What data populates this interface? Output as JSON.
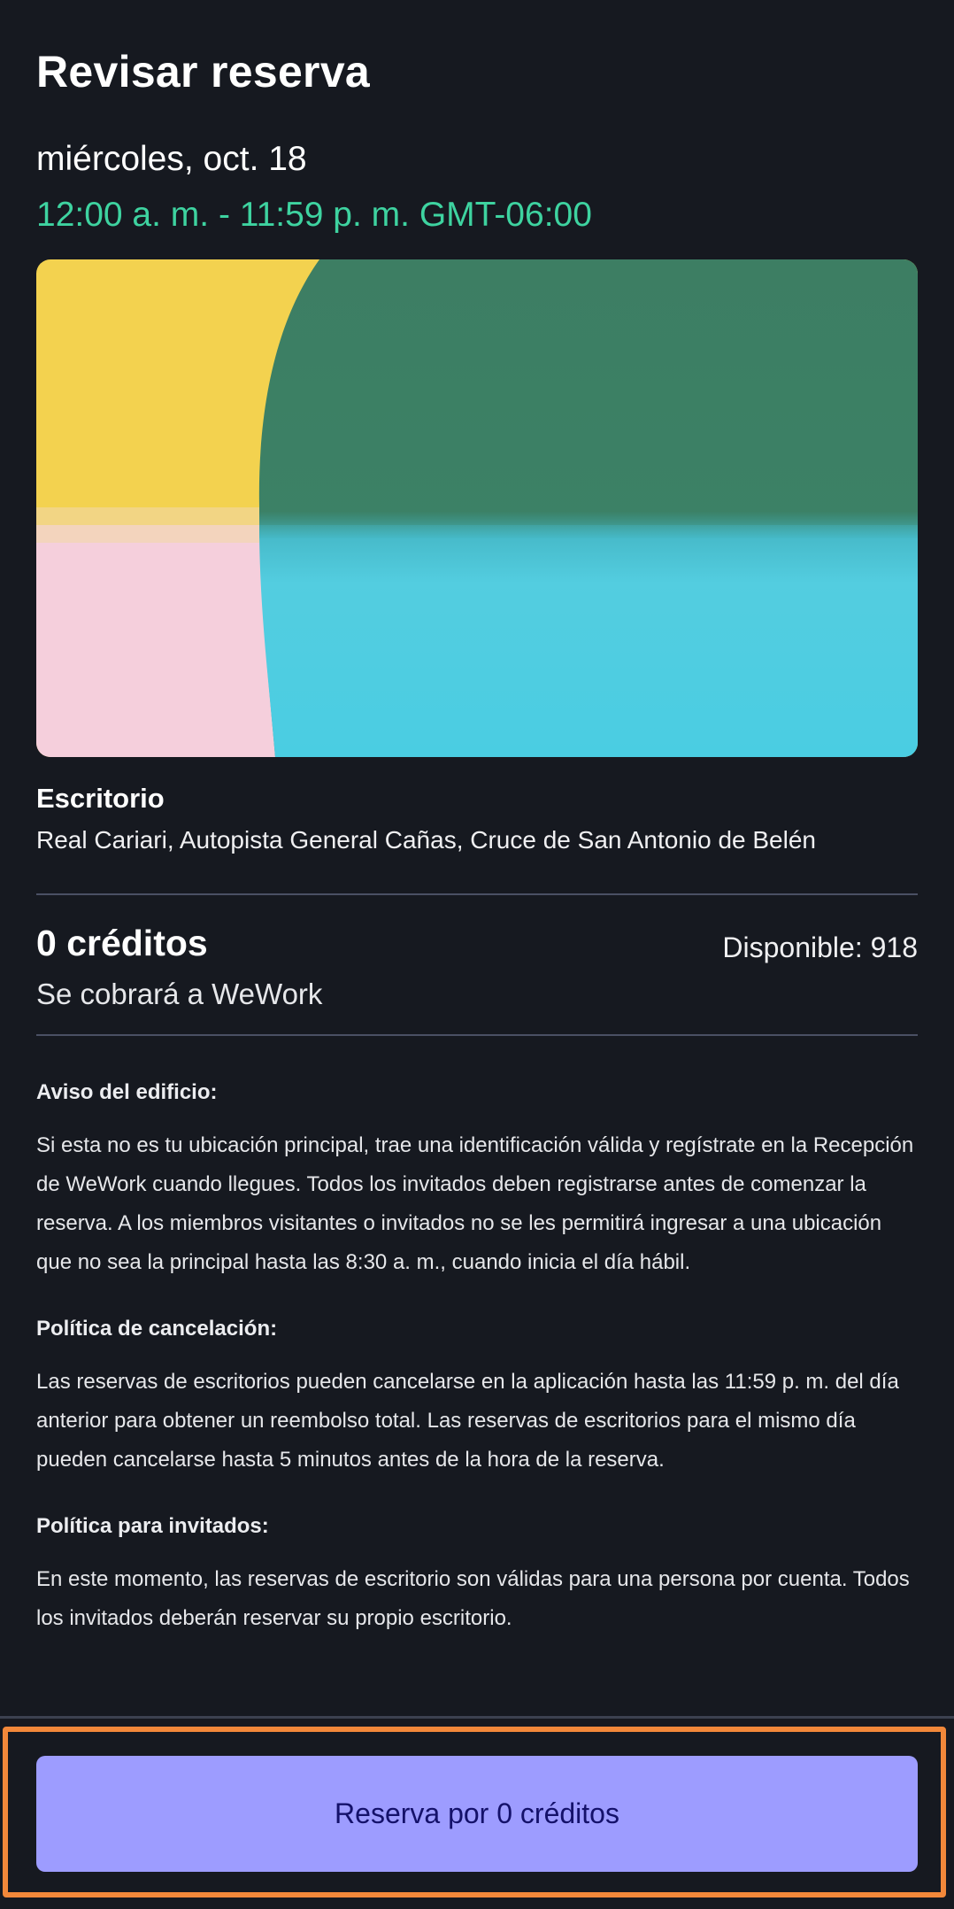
{
  "header": {
    "title": "Revisar reserva"
  },
  "booking": {
    "date": "miércoles, oct. 18",
    "time_range": "12:00 a. m. - 11:59 p. m. GMT-06:00"
  },
  "space": {
    "type": "Escritorio",
    "address": "Real Cariari, Autopista General Cañas, Cruce de San Antonio de Belén"
  },
  "pricing": {
    "credits": "0 créditos",
    "available": "Disponible: 918",
    "charged_to": "Se cobrará a WeWork"
  },
  "notices": [
    {
      "title": "Aviso del edificio:",
      "body": "Si esta no es tu ubicación principal, trae una identificación válida y regístrate en la Recepción de WeWork cuando llegues. Todos los invitados deben registrarse antes de comenzar la reserva. A los miembros visitantes o invitados no se les permitirá ingresar a una ubicación que no sea la principal hasta las 8:30 a. m., cuando inicia el día hábil."
    },
    {
      "title": "Política de cancelación:",
      "body": "Las reservas de escritorios pueden cancelarse en la aplicación hasta las 11:59 p. m. del día anterior para obtener un reembolso total. Las reservas de escritorios para el mismo día pueden cancelarse hasta 5 minutos antes de la hora de la reserva."
    },
    {
      "title": "Política para invitados:",
      "body": "En este momento, las reservas de escritorio son válidas para una persona por cuenta. Todos los invitados deberán reservar su propio escritorio."
    }
  ],
  "footer": {
    "book_button_label": "Reserva por 0 créditos"
  },
  "colors": {
    "background": "#161920",
    "accent_time": "#3ed3a0",
    "button_bg": "#9d9cff",
    "button_text": "#14116a",
    "highlight": "#f2883a"
  }
}
